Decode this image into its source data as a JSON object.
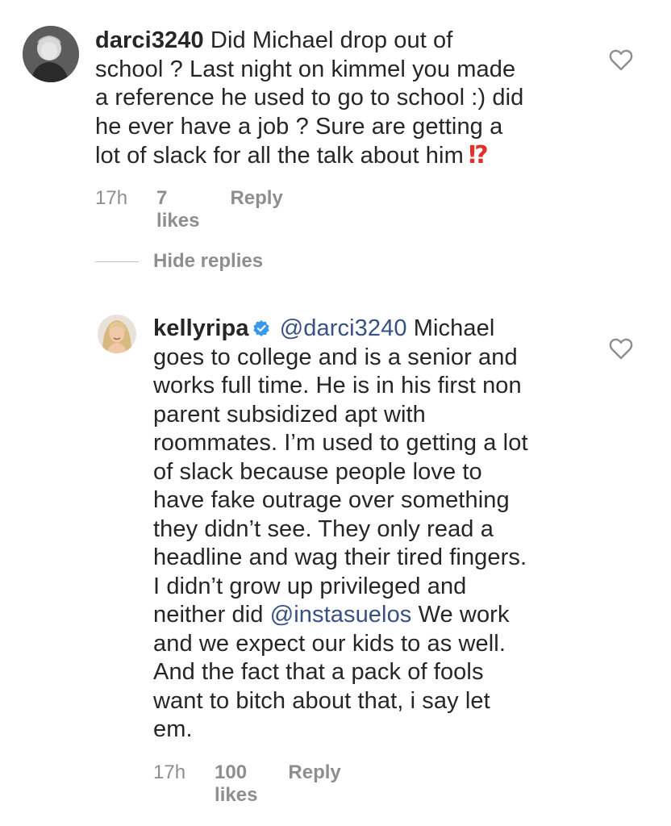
{
  "comment": {
    "username": "darci3240",
    "text": "Did Michael drop out of\nschool ? Last night on kimmel you made\na reference he used to go to school :) did\nhe ever have a job ? Sure are getting a\nlot of slack for all the talk about him",
    "emoji": "⁉",
    "time": "17h",
    "likes": "7 likes",
    "reply": "Reply"
  },
  "hide_replies": "Hide replies",
  "reply": {
    "username": "kellyripa",
    "mention": "@darci3240",
    "text_1": "Michael\ngoes to college and is a senior and\nworks full time. He is in his first non\nparent subsidized apt with\nroommates. I’m used to getting a lot\nof slack because people love to\nhave fake outrage over something\nthey didn’t see. They only read a\nheadline and wag their tired fingers.\nI didn’t grow up privileged and\nneither did ",
    "mention_2": "@instasuelos",
    "text_2": " We work\nand we expect our kids to as well.\nAnd the fact that a pack of fools\nwant to bitch about that, i say let\nem.",
    "time": "17h",
    "likes": "100 likes",
    "reply": "Reply"
  },
  "colors": {
    "text": "#262626",
    "meta": "#8e8e8e",
    "mention": "#385185",
    "verified": "#3897f0"
  },
  "icons": [
    "heart-icon",
    "verified-badge-icon"
  ]
}
